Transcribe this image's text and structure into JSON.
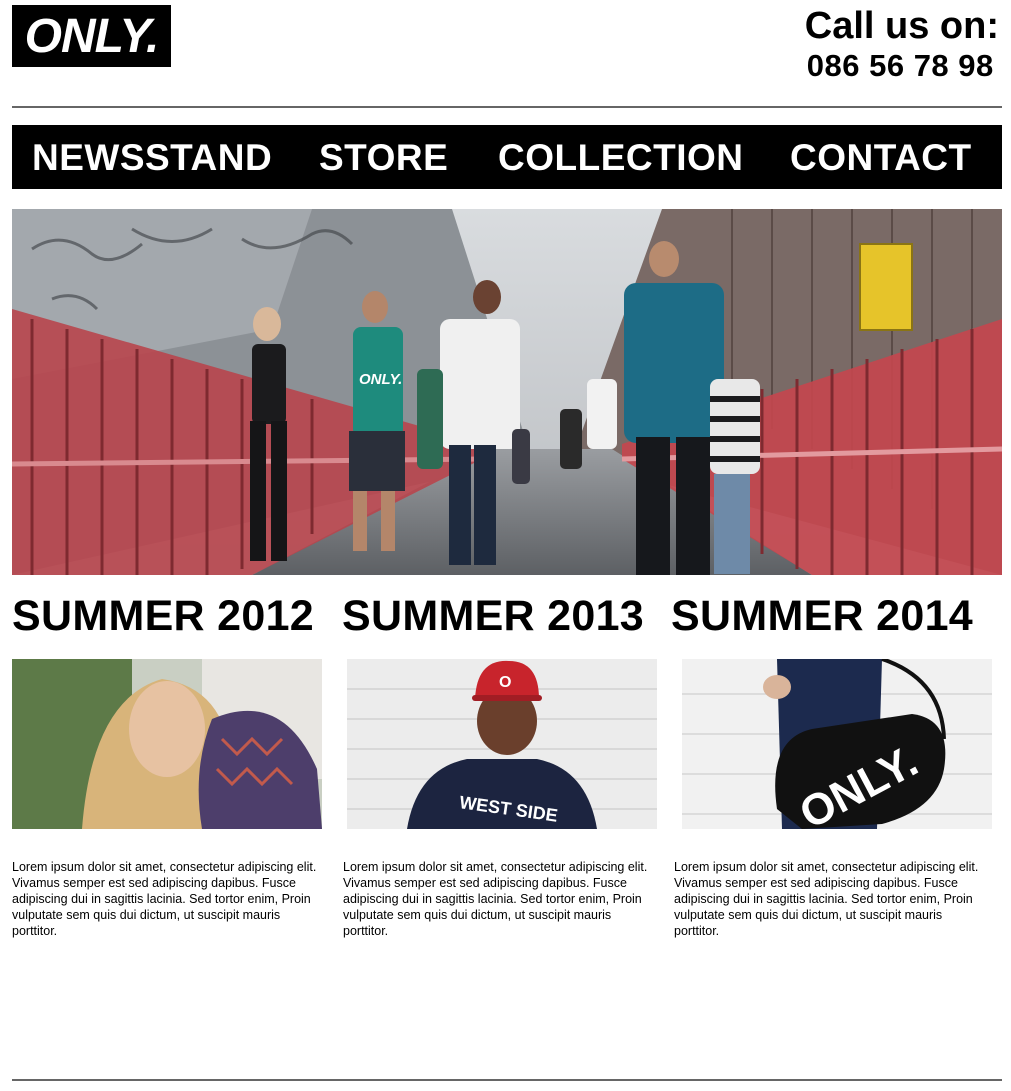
{
  "brand": {
    "logo_text": "ONLY."
  },
  "contact": {
    "label": "Call us on:",
    "phone": "086 56 78 98"
  },
  "nav": {
    "items": [
      {
        "label": "NEWSSTAND"
      },
      {
        "label": "STORE"
      },
      {
        "label": "COLLECTION"
      },
      {
        "label": "CONTACT"
      }
    ]
  },
  "hero": {
    "shirt_text": "ONLY."
  },
  "collections": [
    {
      "title": "SUMMER 2012",
      "text": "Lorem ipsum dolor sit amet, consectetur adipiscing elit. Vivamus semper est sed adipiscing dapibus. Fusce adipiscing dui in sagittis lacinia. Sed tortor enim, Proin vulputate sem quis dui dictum, ut suscipit mauris porttitor."
    },
    {
      "title": "SUMMER 2013",
      "text": "Lorem ipsum dolor sit amet, consectetur adipiscing elit. Vivamus semper est sed adipiscing dapibus. Fusce adipiscing dui in sagittis lacinia. Sed tortor enim, Proin vulputate sem quis dui dictum, ut suscipit mauris porttitor.",
      "photo_text": {
        "cap": "O",
        "shirt": "WEST SIDE"
      }
    },
    {
      "title": "SUMMER 2014",
      "text": "Lorem ipsum dolor sit amet, consectetur adipiscing elit. Vivamus semper est sed adipiscing dapibus. Fusce adipiscing dui in sagittis lacinia. Sed tortor enim, Proin vulputate sem quis dui dictum, ut suscipit mauris porttitor.",
      "photo_text": {
        "bag": "ONLY."
      }
    }
  ],
  "colors": {
    "nav_bg": "#000000",
    "nav_text": "#ffffff",
    "railing": "#b8454c",
    "rule": "#666666"
  }
}
